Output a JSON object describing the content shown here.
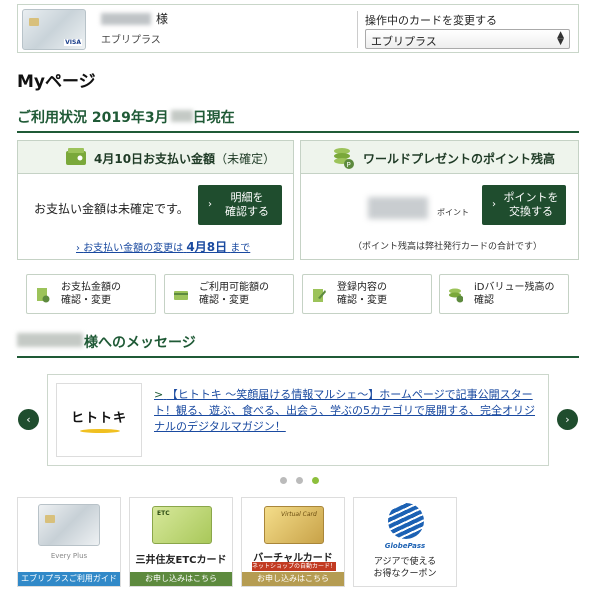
{
  "header": {
    "honorific": "様",
    "brand": "エブリプラス",
    "change_label": "操作中のカードを変更する",
    "selected_card": "エブリプラス",
    "card_visa": "VISA"
  },
  "page_title": "Myページ",
  "status": {
    "title_prefix": "ご利用状況 2019年3月",
    "title_suffix": "日現在"
  },
  "payment": {
    "head_title": "4月10日お支払い金額",
    "head_sub": "（未確定）",
    "text": "お支払い金額は未確定です。",
    "button_line1": "明細を",
    "button_line2": "確認する",
    "link_prefix": "お支払い金額の変更は",
    "link_date": "4月8日",
    "link_suffix": "まで"
  },
  "points": {
    "head_title": "ワールドプレゼントのポイント残高",
    "unit": "ポイント",
    "button_line1": "ポイントを",
    "button_line2": "交換する",
    "note": "（ポイント残高は弊社発行カードの合計です）"
  },
  "quick_links": [
    {
      "line1": "お支払金額の",
      "line2": "確認・変更"
    },
    {
      "line1": "ご利用可能額の",
      "line2": "確認・変更"
    },
    {
      "line1": "登録内容の",
      "line2": "確認・変更"
    },
    {
      "line1": "iDバリュー残高の",
      "line2": "確認"
    }
  ],
  "messages": {
    "title": "様へのメッセージ",
    "carousel": {
      "logo_text": "ヒトトキ",
      "marker": ">",
      "body": "【ヒトトキ ～笑顔届ける情報マルシェ～】ホームページで記事公開スタート！観る、遊ぶ、食べる、出会う、学ぶの5カテゴリで展開する、完全オリジナルのデジタルマガジン！",
      "prev": "‹",
      "next": "›"
    }
  },
  "banners": [
    {
      "caption": "Every Plus",
      "foot": "エブリプラスご利用ガイド"
    },
    {
      "card_label": "ETC",
      "title": "三井住友ETCカード",
      "foot": "お申し込みはこちら"
    },
    {
      "card_label": "Virtual Card",
      "title": "バーチャルカード",
      "tag": "ネットショップの自動カード！",
      "foot": "お申し込みはこちら"
    },
    {
      "name": "GlobePass",
      "line1": "アジアで使える",
      "line2": "お得なクーポン"
    }
  ],
  "colors": {
    "brand_green": "#1f5a36",
    "button_green": "#1f4d2e",
    "link_blue": "#1a4aa0",
    "dot_active": "#8dbf3c"
  }
}
